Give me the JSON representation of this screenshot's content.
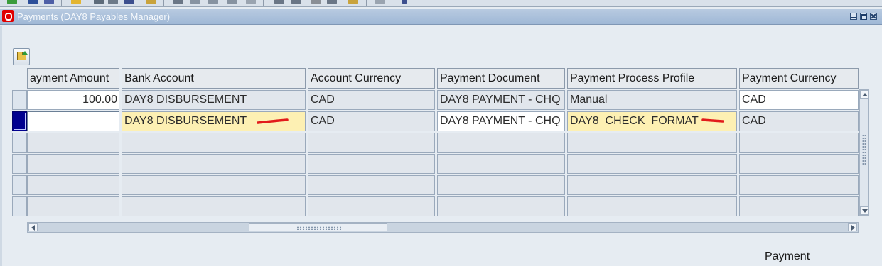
{
  "window": {
    "title": "Payments (DAY8 Payables Manager)"
  },
  "columns": [
    {
      "key": "amount",
      "label": "ayment Amount"
    },
    {
      "key": "bank",
      "label": "Bank Account"
    },
    {
      "key": "acct_currency",
      "label": "Account Currency"
    },
    {
      "key": "document",
      "label": "Payment Document"
    },
    {
      "key": "profile",
      "label": "Payment Process Profile"
    },
    {
      "key": "pay_currency",
      "label": "Payment Currency"
    }
  ],
  "rows": [
    {
      "amount": "100.00",
      "bank": "DAY8 DISBURSEMENT",
      "acct_currency": "CAD",
      "document": "DAY8 PAYMENT - CHQ",
      "profile": "Manual",
      "pay_currency": "CAD"
    },
    {
      "amount": "",
      "bank": "DAY8 DISBURSEMENT",
      "acct_currency": "CAD",
      "document": "DAY8 PAYMENT - CHQ",
      "profile": "DAY8_CHECK_FORMAT",
      "pay_currency": "CAD"
    },
    {
      "amount": "",
      "bank": "",
      "acct_currency": "",
      "document": "",
      "profile": "",
      "pay_currency": ""
    },
    {
      "amount": "",
      "bank": "",
      "acct_currency": "",
      "document": "",
      "profile": "",
      "pay_currency": ""
    },
    {
      "amount": "",
      "bank": "",
      "acct_currency": "",
      "document": "",
      "profile": "",
      "pay_currency": ""
    },
    {
      "amount": "",
      "bank": "",
      "acct_currency": "",
      "document": "",
      "profile": "",
      "pay_currency": ""
    }
  ],
  "footer": {
    "label": "Payment"
  },
  "colors": {
    "title_bar": "#a9c0dc",
    "highlight_field": "#fdf0b3",
    "current_record": "#00008f",
    "annotation": "#e21b1b"
  },
  "icons": {
    "folder": "folder-open-icon",
    "app": "oracle-icon"
  }
}
